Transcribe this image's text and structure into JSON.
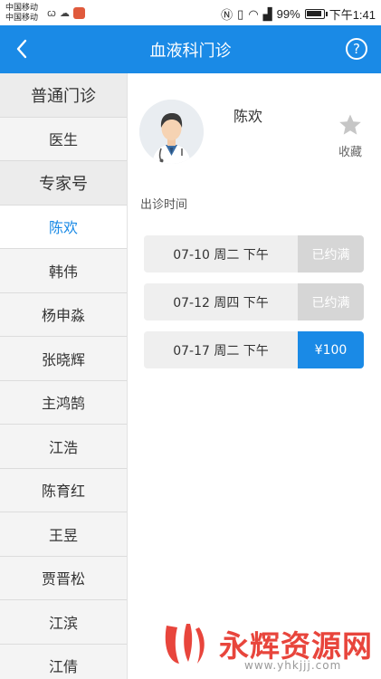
{
  "status_bar": {
    "carrier_line1": "中国移动",
    "carrier_line2": "中国移动",
    "signal_labels": "N ⌷ ≋ ⁴⁶ ",
    "battery_percent": "99%",
    "time": "下午1:41"
  },
  "header": {
    "title": "血液科门诊",
    "help_symbol": "?"
  },
  "sidebar": {
    "items": [
      {
        "label": "普通门诊",
        "type": "header"
      },
      {
        "label": "医生",
        "type": "item"
      },
      {
        "label": "专家号",
        "type": "header"
      },
      {
        "label": "陈欢",
        "type": "item",
        "active": true
      },
      {
        "label": "韩伟",
        "type": "item"
      },
      {
        "label": "杨申淼",
        "type": "item"
      },
      {
        "label": "张晓辉",
        "type": "item"
      },
      {
        "label": "主鸿鹄",
        "type": "item"
      },
      {
        "label": "江浩",
        "type": "item"
      },
      {
        "label": "陈育红",
        "type": "item"
      },
      {
        "label": "王昱",
        "type": "item"
      },
      {
        "label": "贾晋松",
        "type": "item"
      },
      {
        "label": "江滨",
        "type": "item"
      },
      {
        "label": "江倩",
        "type": "item"
      }
    ]
  },
  "doctor": {
    "name": "陈欢",
    "favorite_label": "收藏"
  },
  "schedule": {
    "section_label": "出诊时间",
    "slots": [
      {
        "time": "07-10  周二  下午",
        "action": "已约满",
        "state": "full"
      },
      {
        "time": "07-12  周四  下午",
        "action": "已约满",
        "state": "full"
      },
      {
        "time": "07-17  周二  下午",
        "action": "¥100",
        "state": "available"
      }
    ]
  },
  "watermark": {
    "text": "永辉资源网",
    "url": "www.yhkjjj.com"
  },
  "colors": {
    "accent": "#1a8ae6",
    "full_bg": "#d6d6d6",
    "watermark": "#e8453c"
  }
}
